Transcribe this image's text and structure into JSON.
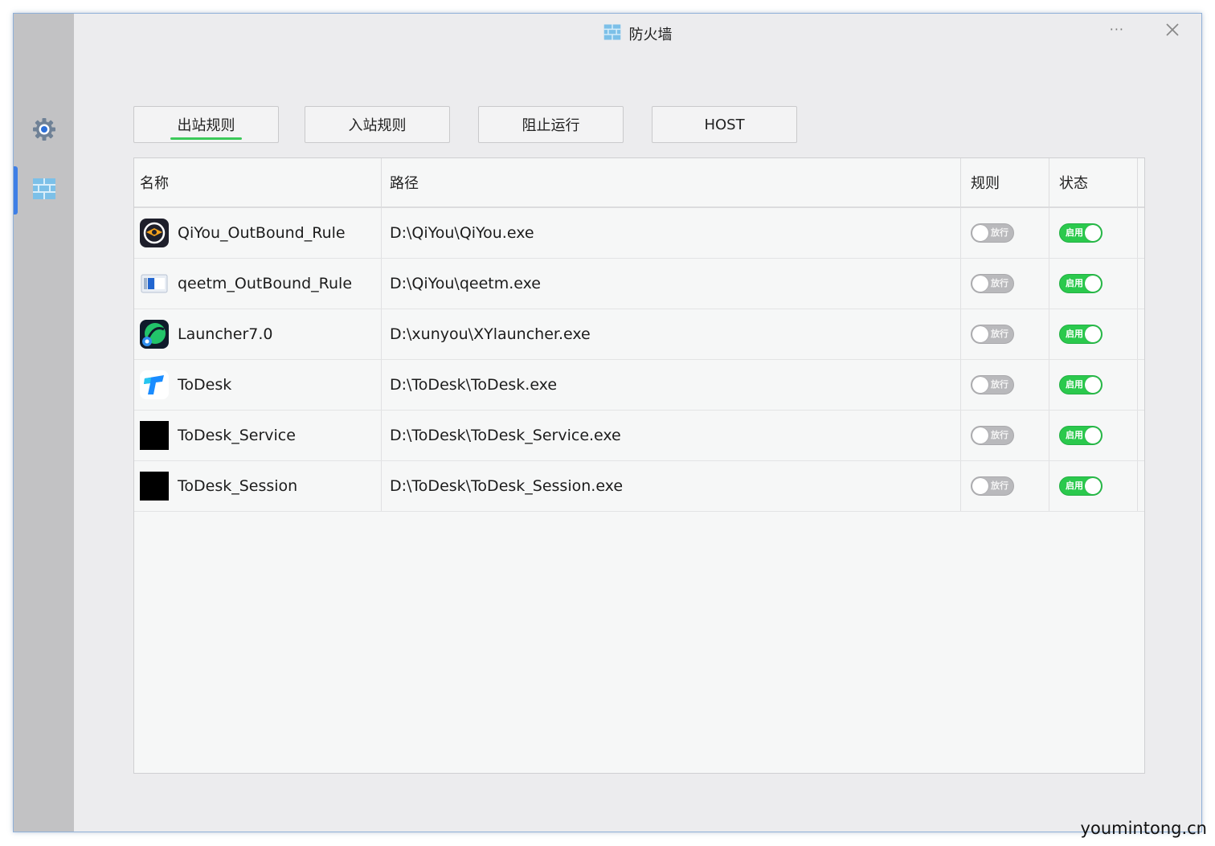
{
  "window": {
    "title": "防火墙",
    "more_label": "···"
  },
  "sidebar": {
    "items": [
      {
        "id": "settings",
        "icon": "gear-icon"
      },
      {
        "id": "firewall",
        "icon": "brick-wall-icon",
        "active": true
      }
    ]
  },
  "tabs": [
    {
      "label": "出站规则",
      "active": true
    },
    {
      "label": "入站规则",
      "active": false
    },
    {
      "label": "阻止运行",
      "active": false
    },
    {
      "label": "HOST",
      "active": false
    }
  ],
  "table": {
    "columns": [
      "名称",
      "路径",
      "规则",
      "状态"
    ],
    "rows": [
      {
        "name": "QiYou_OutBound_Rule",
        "path": "D:\\QiYou\\QiYou.exe",
        "icon": "qiyou-app-icon",
        "rule_label": "放行",
        "rule_on": false,
        "state_label": "启用",
        "state_on": true
      },
      {
        "name": "qeetm_OutBound_Rule",
        "path": "D:\\QiYou\\qeetm.exe",
        "icon": "qeetm-app-icon",
        "rule_label": "放行",
        "rule_on": false,
        "state_label": "启用",
        "state_on": true
      },
      {
        "name": "Launcher7.0",
        "path": "D:\\xunyou\\XYlauncher.exe",
        "icon": "launcher-app-icon",
        "rule_label": "放行",
        "rule_on": false,
        "state_label": "启用",
        "state_on": true
      },
      {
        "name": "ToDesk",
        "path": "D:\\ToDesk\\ToDesk.exe",
        "icon": "todesk-app-icon",
        "rule_label": "放行",
        "rule_on": false,
        "state_label": "启用",
        "state_on": true
      },
      {
        "name": "ToDesk_Service",
        "path": "D:\\ToDesk\\ToDesk_Service.exe",
        "icon": "blank-app-icon",
        "rule_label": "放行",
        "rule_on": false,
        "state_label": "启用",
        "state_on": true
      },
      {
        "name": "ToDesk_Session",
        "path": "D:\\ToDesk\\ToDesk_Session.exe",
        "icon": "blank-app-icon",
        "rule_label": "放行",
        "rule_on": false,
        "state_label": "启用",
        "state_on": true
      }
    ]
  },
  "colors": {
    "accent": "#3e7fe6",
    "toggle_on": "#2bc94d",
    "toggle_off": "#b9b9bc",
    "tab_underline": "#3cc95a"
  },
  "watermark": "youmintong.cn"
}
